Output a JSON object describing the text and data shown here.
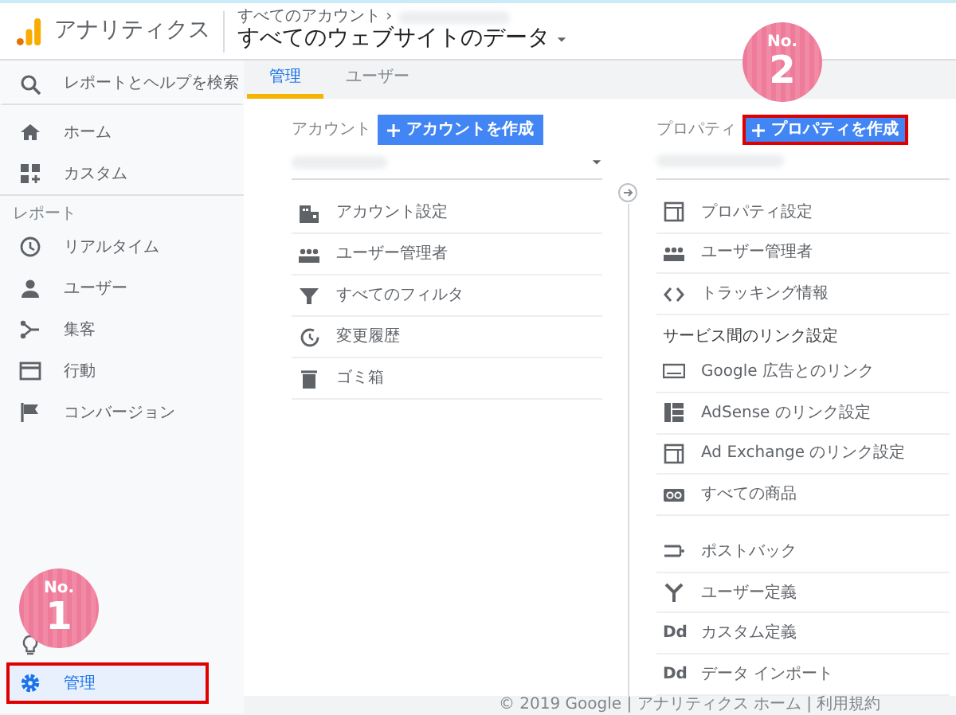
{
  "header": {
    "app_name": "アナリティクス",
    "breadcrumb": "すべてのアカウント ›",
    "view_title": "すべてのウェブサイトのデータ"
  },
  "sidebar": {
    "search_label": "レポートとヘルプを検索",
    "items": [
      {
        "label": "ホーム",
        "selected": false
      },
      {
        "label": "カスタム",
        "selected": false
      }
    ],
    "section_label": "レポート",
    "report_items": [
      {
        "label": "リアルタイム",
        "selected": false
      },
      {
        "label": "ユーザー",
        "selected": false
      },
      {
        "label": "集客",
        "selected": false
      },
      {
        "label": "行動",
        "selected": false
      },
      {
        "label": "コンバージョン",
        "selected": false
      }
    ],
    "admin_item": {
      "label": "管理",
      "selected": true,
      "highlighted": true
    }
  },
  "tabs": [
    {
      "label": "管理",
      "selected": true
    },
    {
      "label": "ユーザー",
      "selected": false
    }
  ],
  "account_column": {
    "label": "アカウント",
    "create_button": {
      "label": "アカウントを作成",
      "highlighted": false
    },
    "items": [
      {
        "label": "アカウント設定"
      },
      {
        "label": "ユーザー管理者"
      },
      {
        "label": "すべてのフィルタ"
      },
      {
        "label": "変更履歴"
      },
      {
        "label": "ゴミ箱"
      }
    ]
  },
  "property_column": {
    "label": "プロパティ",
    "create_button": {
      "label": "プロパティを作成",
      "highlighted": true
    },
    "items": [
      {
        "label": "プロパティ設定"
      },
      {
        "label": "ユーザー管理者"
      },
      {
        "label": "トラッキング情報"
      }
    ],
    "section_label": "サービス間のリンク設定",
    "link_items": [
      {
        "label": "Google 広告とのリンク"
      },
      {
        "label": "AdSense のリンク設定"
      },
      {
        "label": "Ad Exchange のリンク設定"
      },
      {
        "label": "すべての商品"
      }
    ],
    "more_items": [
      {
        "label": "ポストバック"
      },
      {
        "label": "ユーザー定義"
      },
      {
        "label": "カスタム定義",
        "icon_text": "Dd"
      },
      {
        "label": "データ インポート",
        "icon_text": "Dd"
      }
    ]
  },
  "footer": {
    "text": "© 2019 Google | アナリティクス ホーム | 利用規約"
  },
  "annotations": [
    {
      "prefix": "No.",
      "number": "1"
    },
    {
      "prefix": "No.",
      "number": "2"
    }
  ]
}
